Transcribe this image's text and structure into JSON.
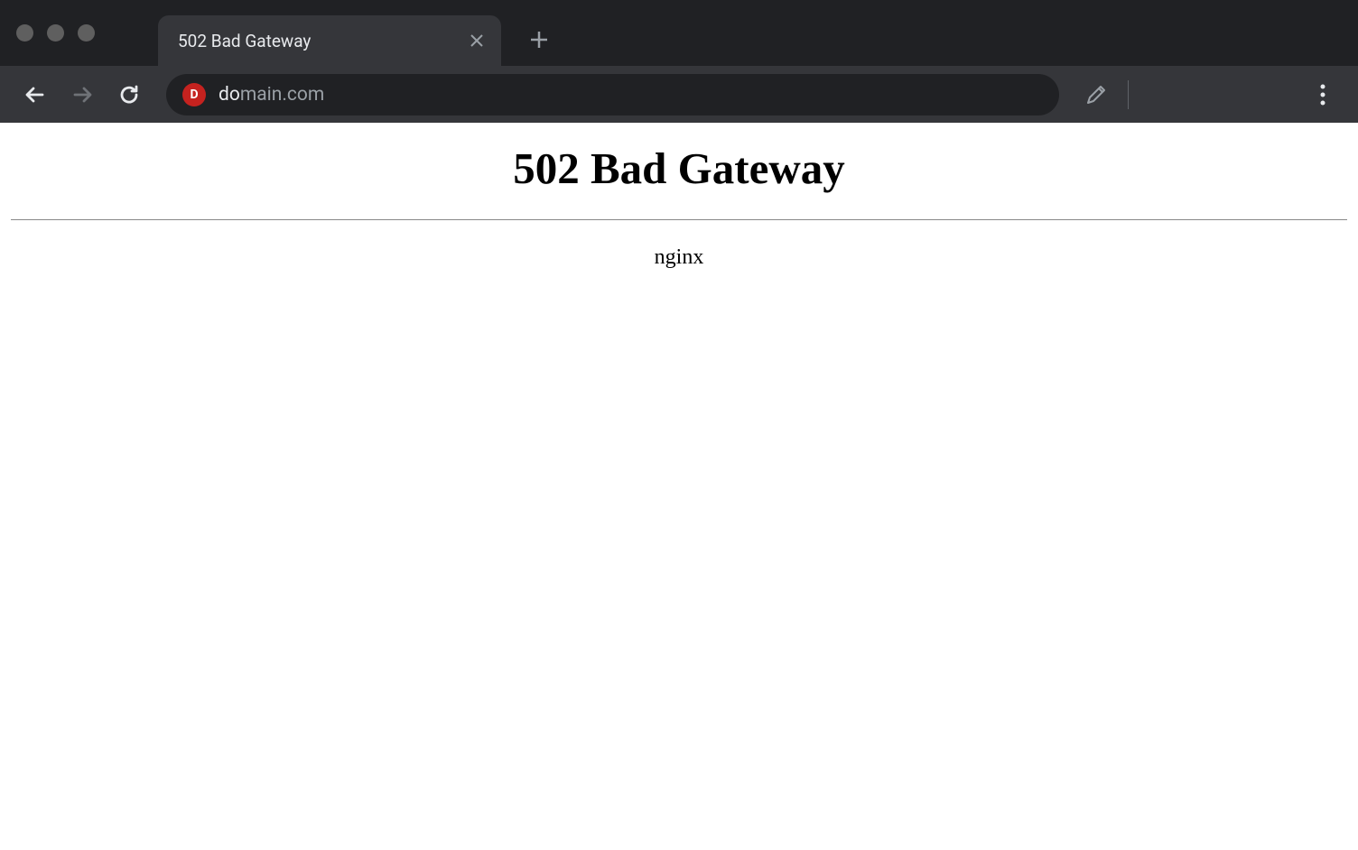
{
  "browser": {
    "tab": {
      "title": "502 Bad Gateway"
    },
    "address": {
      "url": "domain.com",
      "domain": "do",
      "rest": "main.com"
    }
  },
  "page": {
    "heading": "502 Bad Gateway",
    "server": "nginx"
  }
}
